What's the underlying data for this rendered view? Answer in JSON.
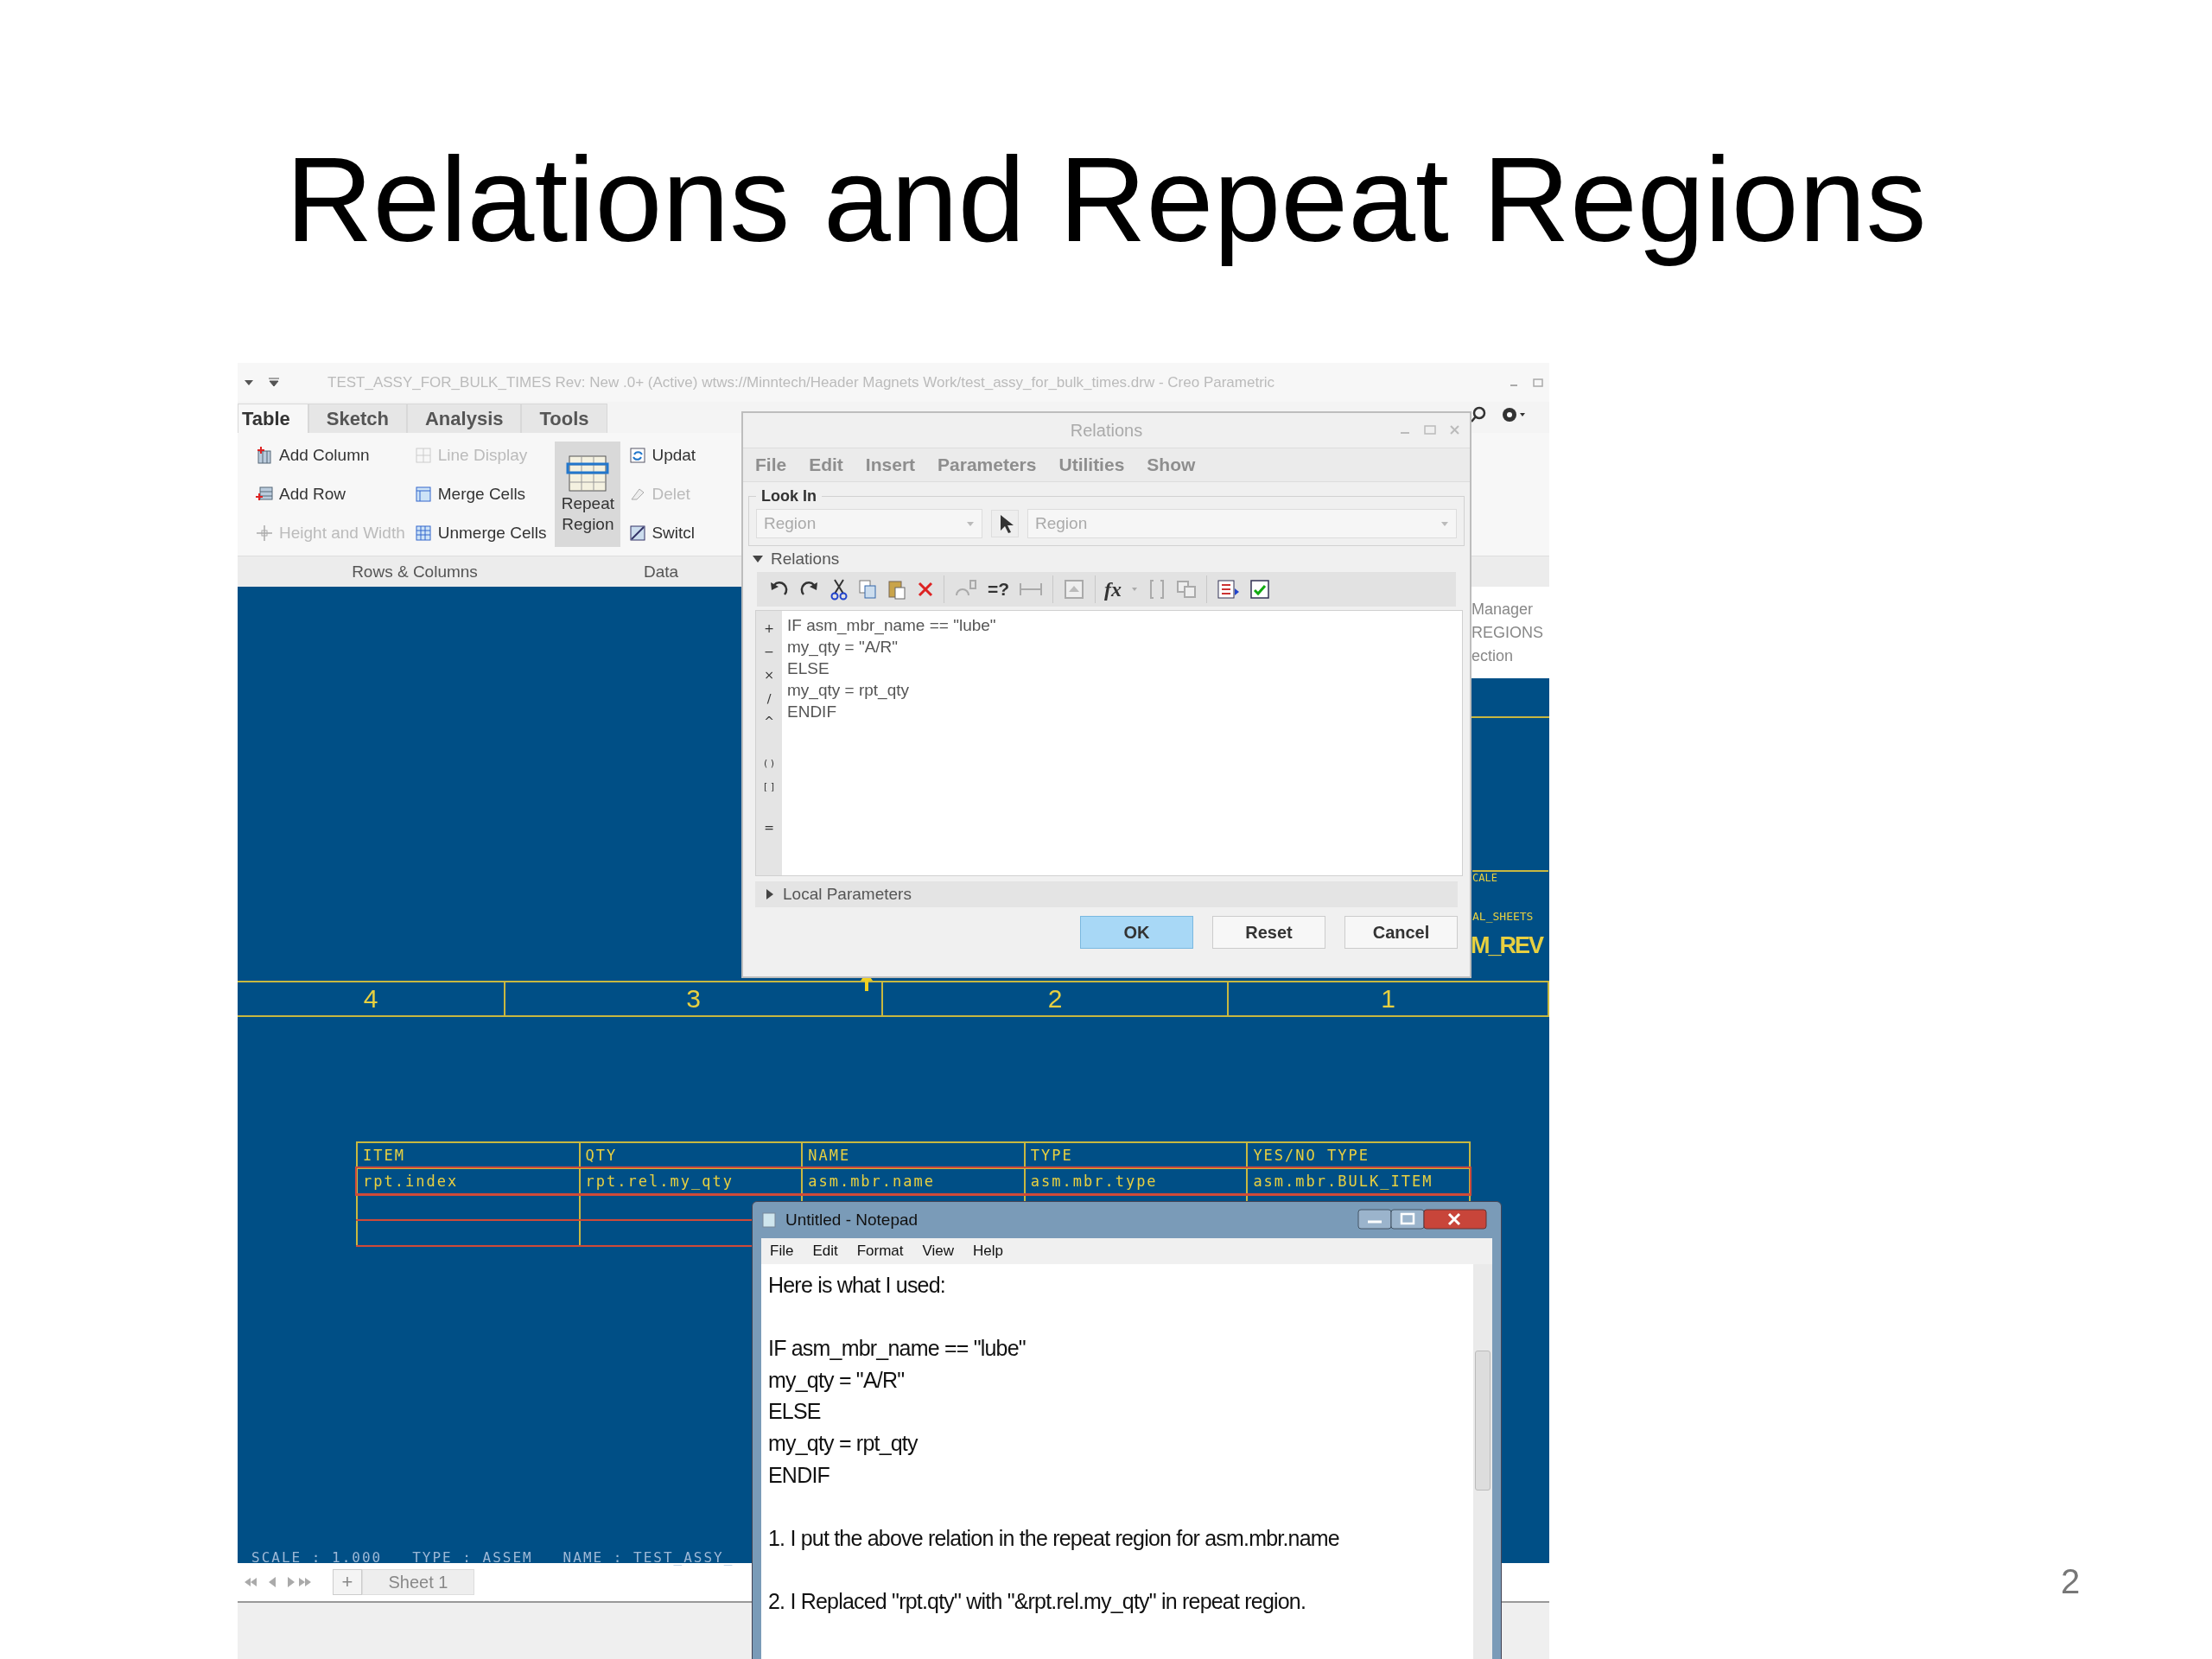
{
  "slide": {
    "title": "Relations and Repeat Regions",
    "page_number": "2"
  },
  "app": {
    "title": "TEST_ASSY_FOR_BULK_TIMES Rev: New .0+   (Active) wtws://Minntech/Header Magnets Work/test_assy_for_bulk_times.drw - Creo Parametric",
    "tabs": [
      {
        "label": "Table",
        "selected": true
      },
      {
        "label": "Sketch",
        "selected": false
      },
      {
        "label": "Analysis",
        "selected": false
      },
      {
        "label": "Tools",
        "selected": false
      }
    ],
    "ribbon_columns": [
      [
        {
          "label": "Add Column",
          "disabled": false
        },
        {
          "label": "Add Row",
          "disabled": false
        },
        {
          "label": "Height and Width",
          "disabled": true
        }
      ],
      [
        {
          "label": "Line Display",
          "disabled": true
        },
        {
          "label": "Merge Cells",
          "disabled": false
        },
        {
          "label": "Unmerge Cells",
          "disabled": false
        }
      ]
    ],
    "big_button": {
      "label_lines": [
        "Repeat",
        "Region"
      ],
      "selected": true
    },
    "data_items": [
      {
        "label": "Updat",
        "disabled": false
      },
      {
        "label": "Delet",
        "disabled": true
      },
      {
        "label": "Switcl",
        "disabled": false
      }
    ],
    "group_labels": [
      "Rows & Columns",
      "Data"
    ],
    "side_panel": [
      "Manager",
      "REGIONS",
      "ection"
    ],
    "sheet_tab": "Sheet 1",
    "add_sheet": "+"
  },
  "drawing": {
    "zones": [
      "4",
      "3",
      "2",
      "1"
    ],
    "table": {
      "columns": [
        "ITEM",
        "QTY",
        "NAME",
        "TYPE",
        "YES/NO TYPE"
      ],
      "rows": [
        [
          "rpt.index",
          "rpt.rel.my_qty",
          "asm.mbr.name",
          "asm.mbr.type",
          "asm.mbr.BULK_ITEM"
        ]
      ]
    },
    "title_block": [
      "CALE",
      "AL_SHEETS",
      "M_REV"
    ],
    "scale_line": "SCALE : 1.000   TYPE : ASSEM   NAME : TEST_ASSY_"
  },
  "relations_dialog": {
    "title": "Relations",
    "menu": [
      "File",
      "Edit",
      "Insert",
      "Parameters",
      "Utilities",
      "Show"
    ],
    "look_in": {
      "label": "Look In",
      "type_value": "Region",
      "item_value": "Region"
    },
    "relations_section": {
      "label": "Relations",
      "expanded": true
    },
    "toolbar_texts": [
      "=?",
      "fx"
    ],
    "operators": [
      "+",
      "−",
      "×",
      "/",
      "^",
      "( )",
      "[ ]",
      "="
    ],
    "code": [
      "IF asm_mbr_name == \"lube\"",
      "my_qty = \"A/R\"",
      "ELSE",
      "my_qty = rpt_qty",
      "ENDIF"
    ],
    "local_parameters": {
      "label": "Local Parameters",
      "expanded": false
    },
    "buttons": [
      {
        "label": "OK",
        "primary": true
      },
      {
        "label": "Reset",
        "primary": false
      },
      {
        "label": "Cancel",
        "primary": false
      }
    ]
  },
  "notepad": {
    "title": "Untitled - Notepad",
    "menu": [
      "File",
      "Edit",
      "Format",
      "View",
      "Help"
    ],
    "paragraphs": [
      [
        "Here is what I used:"
      ],
      [
        "IF asm_mbr_name == \"lube\"",
        "my_qty = \"A/R\"",
        "ELSE",
        "my_qty = rpt_qty",
        "ENDIF"
      ],
      [
        "1. I put the above relation in the repeat region for asm.mbr.name"
      ],
      [
        "2. I Replaced \"rpt.qty\" with \"&rpt.rel.my_qty\" in repeat region."
      ]
    ]
  }
}
